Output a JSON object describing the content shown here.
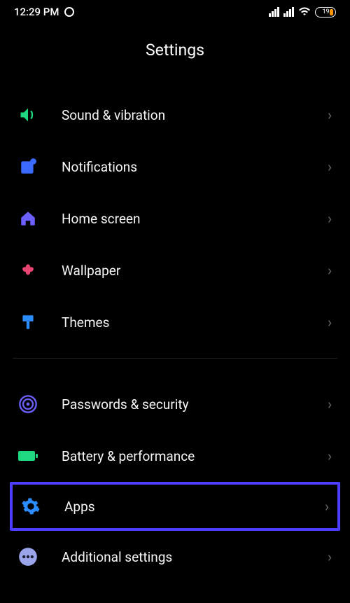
{
  "status": {
    "time": "12:29 PM",
    "battery_percent": "19"
  },
  "page": {
    "title": "Settings"
  },
  "items": [
    {
      "label": "Sound & vibration"
    },
    {
      "label": "Notifications"
    },
    {
      "label": "Home screen"
    },
    {
      "label": "Wallpaper"
    },
    {
      "label": "Themes"
    },
    {
      "label": "Passwords & security"
    },
    {
      "label": "Battery & performance"
    },
    {
      "label": "Apps"
    },
    {
      "label": "Additional settings"
    }
  ]
}
